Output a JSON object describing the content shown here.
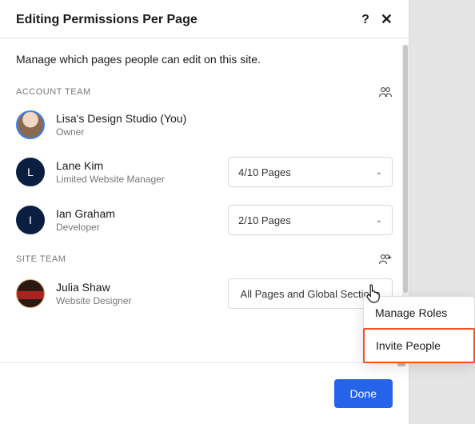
{
  "header": {
    "title": "Editing Permissions Per Page",
    "help_label": "?",
    "close_label": "✕"
  },
  "intro": "Manage which pages people can edit on this site.",
  "sections": {
    "account": {
      "title": "ACCOUNT TEAM",
      "icon": "people-icon",
      "members": [
        {
          "name": "Lisa's Design Studio (You)",
          "role": "Owner",
          "avatar_type": "image",
          "pages": null
        },
        {
          "name": "Lane Kim",
          "role": "Limited Website Manager",
          "avatar_type": "letter",
          "avatar_letter": "L",
          "pages": "4/10 Pages"
        },
        {
          "name": "Ian Graham",
          "role": "Developer",
          "avatar_type": "letter",
          "avatar_letter": "I",
          "pages": "2/10 Pages"
        }
      ]
    },
    "site": {
      "title": "SITE TEAM",
      "icon": "add-people-icon",
      "members": [
        {
          "name": "Julia Shaw",
          "role": "Website Designer",
          "avatar_type": "image",
          "pages": "All Pages and Global Sections",
          "no_chevron": true
        }
      ]
    }
  },
  "popover": {
    "items": [
      {
        "label": "Manage Roles",
        "highlight": false
      },
      {
        "label": "Invite People",
        "highlight": true
      }
    ]
  },
  "footer": {
    "done_label": "Done"
  }
}
